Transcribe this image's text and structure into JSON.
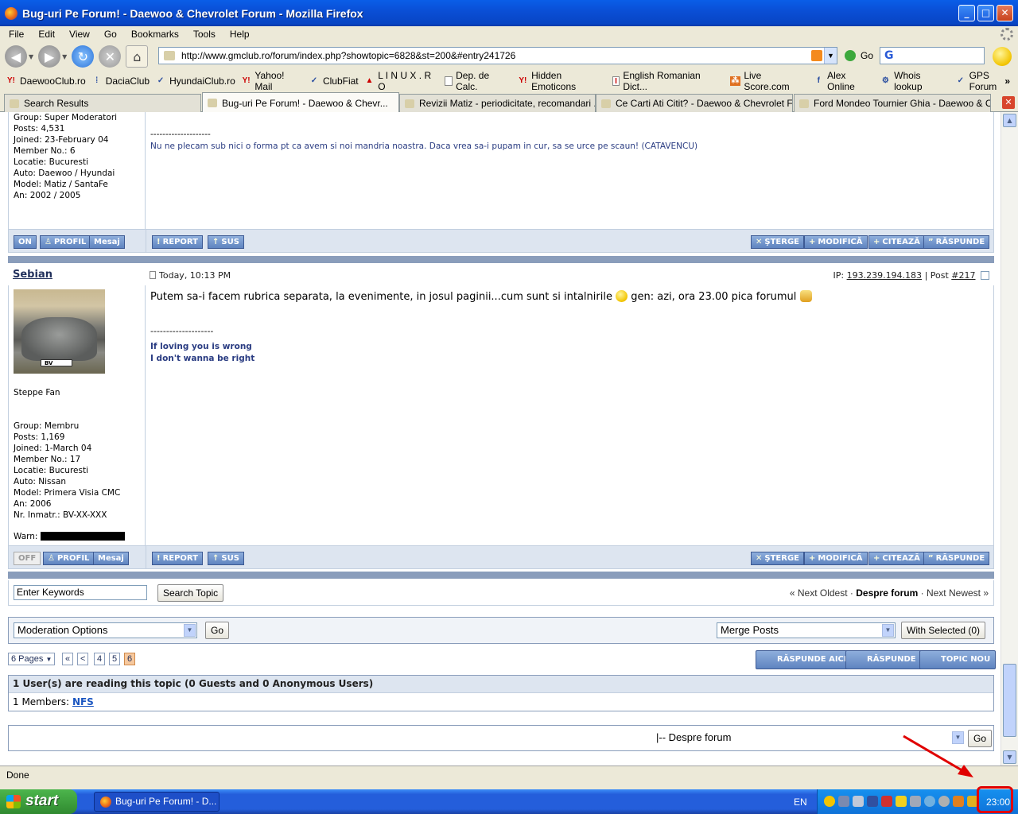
{
  "window": {
    "title": "Bug-uri Pe Forum! - Daewoo & Chevrolet Forum - Mozilla Firefox"
  },
  "menu": [
    "File",
    "Edit",
    "View",
    "Go",
    "Bookmarks",
    "Tools",
    "Help"
  ],
  "nav": {
    "url": "http://www.gmclub.ro/forum/index.php?showtopic=6828&st=200&#entry241726",
    "go_label": "Go"
  },
  "bookmarks": [
    "DaewooClub.ro",
    "DaciaClub",
    "HyundaiClub.ro",
    "Yahoo! Mail",
    "ClubFiat",
    "L I N U X . R O",
    "Dep. de Calc.",
    "Hidden Emoticons",
    "English Romanian Dict...",
    "Live Score.com",
    "Alex Online",
    "Whois lookup",
    "GPS Forum"
  ],
  "tabs": [
    "Search Results",
    "Bug-uri Pe Forum! - Daewoo & Chevr...",
    "Revizii Matiz - periodicitate, recomandari ......",
    "Ce Carti Ati Citit? - Daewoo & Chevrolet Fo...",
    "Ford Mondeo Tournier Ghia - Daewoo & Ch..."
  ],
  "post1": {
    "info": [
      "Group: Super Moderatori",
      "Posts: 4,531",
      "Joined: 23-February 04",
      "Member No.: 6",
      "Locatie: Bucuresti",
      "Auto: Daewoo / Hyundai",
      "Model: Matiz / SantaFe",
      "An: 2002 / 2005"
    ],
    "sig_line": "--------------------",
    "signature": "Nu ne plecam sub nici o forma pt ca avem si noi mandria noastra. Daca vrea sa-i pupam in cur, sa se urce pe scaun! (CATAVENCU)"
  },
  "buttons": {
    "on": "ON",
    "off": "OFF",
    "profil": "PROFIL",
    "mesaj": "Mesaj",
    "report": "REPORT",
    "sus": "SUS",
    "sterge": "ŞTERGE",
    "modifica": "MODIFICĂ",
    "citeaza": "CITEAZĂ",
    "raspunde": "RĂSPUNDE"
  },
  "post2": {
    "author": "Sebian",
    "date": "Today, 10:13 PM",
    "ip_label": "IP:",
    "ip": "193.239.194.183",
    "post_label": "| Post",
    "post_no": "#217",
    "plate": "BV",
    "title": "Steppe Fan",
    "info": [
      "Group: Membru",
      "Posts: 1,169",
      "Joined: 1-March 04",
      "Member No.: 17",
      "Locatie: Bucuresti",
      "Auto: Nissan",
      "Model: Primera Visia CMC",
      "An: 2006",
      "Nr. Inmatr.: BV-XX-XXX"
    ],
    "warn": "Warn:",
    "text_a": "Putem sa-i facem rubrica separata, la evenimente, in josul paginii...cum sunt si intalnirile",
    "text_b": "gen: azi, ora 23.00 pica forumul",
    "sig_line": "--------------------",
    "sig1": "If loving you is wrong",
    "sig2": "I don't wanna be right"
  },
  "search": {
    "placeholder": "Enter Keywords",
    "button": "Search Topic",
    "prev": "« Next Oldest",
    "sep": "·",
    "forum": "Despre forum",
    "next": "Next Newest »"
  },
  "moderation": {
    "options": "Moderation Options",
    "go": "Go",
    "merge": "Merge Posts",
    "with_selected": "With Selected (0)"
  },
  "pagination": {
    "pages": "6 Pages",
    "first": "«",
    "prev": "<",
    "p4": "4",
    "p5": "5",
    "p6": "6"
  },
  "actions": {
    "reply_here": "RĂSPUNDE AICI",
    "reply": "RĂSPUNDE",
    "new_topic": "TOPIC NOU"
  },
  "readers": {
    "header": "1 User(s) are reading this topic (0 Guests and 0 Anonymous Users)",
    "members_label": "1 Members:",
    "member": "NFS"
  },
  "jump": {
    "forum": "|-- Despre forum",
    "go": "Go"
  },
  "status": "Done",
  "taskbar": {
    "start": "start",
    "item": "Bug-uri Pe Forum! - D...",
    "lang": "EN",
    "clock": "23:00"
  }
}
